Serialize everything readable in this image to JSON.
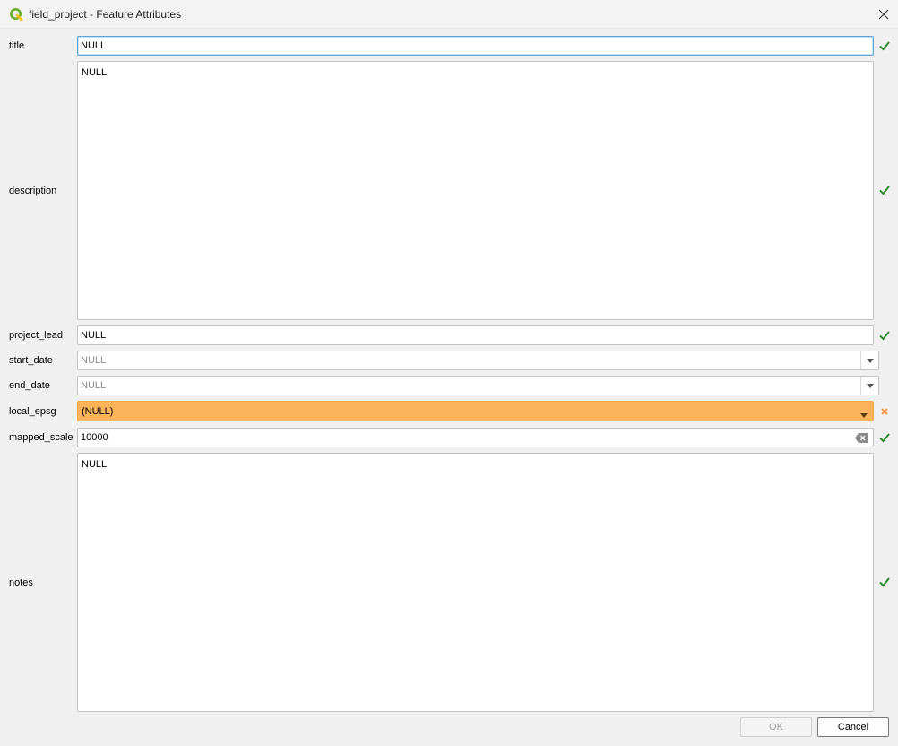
{
  "window": {
    "title": "field_project - Feature Attributes"
  },
  "fields": {
    "title": {
      "label": "title",
      "value": "NULL"
    },
    "description": {
      "label": "description",
      "value": "NULL"
    },
    "project_lead": {
      "label": "project_lead",
      "value": "NULL"
    },
    "start_date": {
      "label": "start_date",
      "value": "NULL"
    },
    "end_date": {
      "label": "end_date",
      "value": "NULL"
    },
    "local_epsg": {
      "label": "local_epsg",
      "value": "(NULL)"
    },
    "mapped_scale": {
      "label": "mapped_scale",
      "value": "10000"
    },
    "notes": {
      "label": "notes",
      "value": "NULL"
    }
  },
  "buttons": {
    "ok": "OK",
    "cancel": "Cancel"
  },
  "colors": {
    "valid": "#2e8b2e",
    "invalid": "#f0962a",
    "invalid_field": "#fbb45a"
  },
  "icons": {
    "app": "qgis-logo-icon",
    "close": "close-icon",
    "valid": "check-icon",
    "invalid": "cross-icon",
    "dropdown": "chevron-down-icon",
    "clear": "clear-input-icon"
  }
}
